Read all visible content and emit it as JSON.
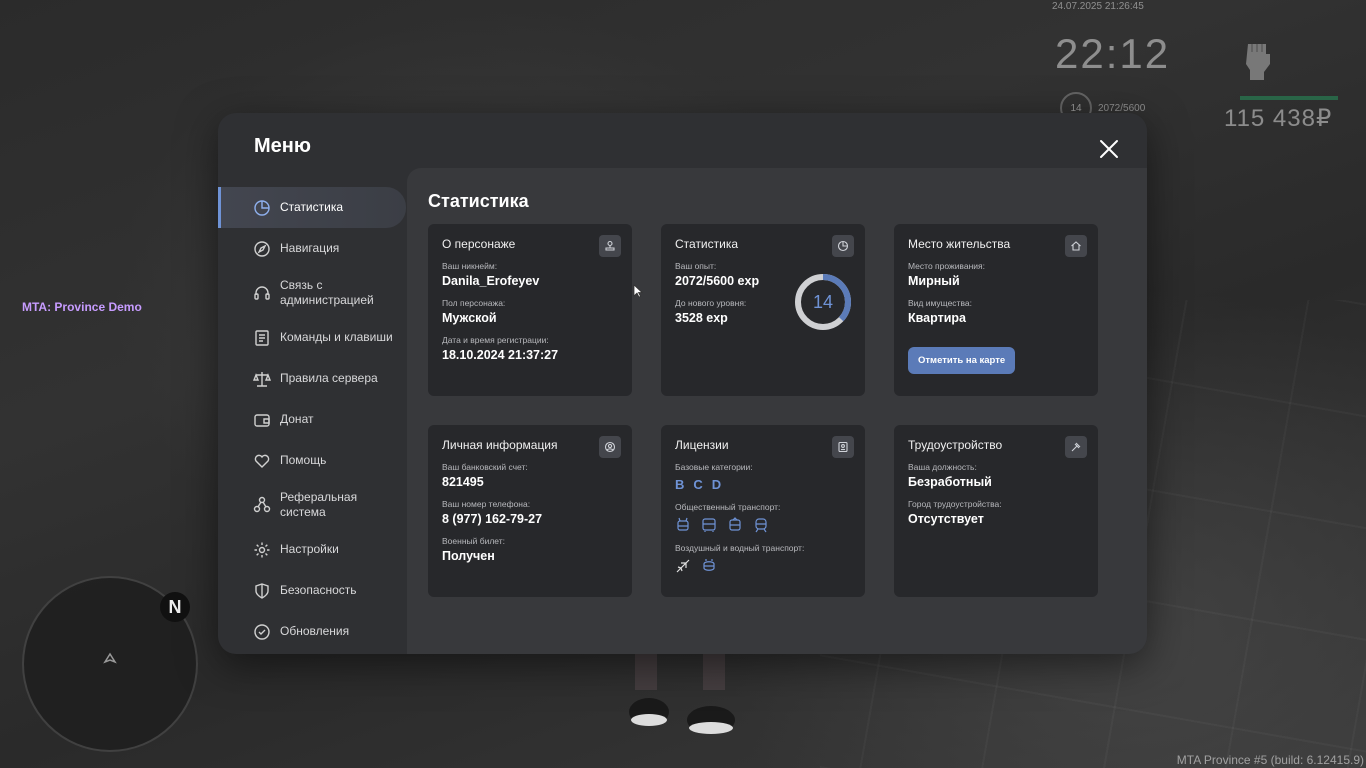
{
  "hud": {
    "date": "24.07.2025 21:26:45",
    "time": "22:12",
    "level": "14",
    "exp": "2072/5600",
    "money": "115 438₽",
    "icon": "fist-icon"
  },
  "server_label": "MTA: Province Demo",
  "build_label": "MTA Province #5 (build: 6.12415.9)",
  "minimap": {
    "compass": "N"
  },
  "menu": {
    "title": "Меню",
    "sidebar": [
      {
        "label": "Статистика",
        "icon": "pie-chart-icon",
        "active": true
      },
      {
        "label": "Навигация",
        "icon": "compass-icon"
      },
      {
        "label": "Связь с\nадминистрацией",
        "icon": "headset-icon"
      },
      {
        "label": "Команды и клавиши",
        "icon": "document-icon"
      },
      {
        "label": "Правила сервера",
        "icon": "scales-icon"
      },
      {
        "label": "Донат",
        "icon": "wallet-icon"
      },
      {
        "label": "Помощь",
        "icon": "heart-hand-icon"
      },
      {
        "label": "Реферальная\nсистема",
        "icon": "network-icon"
      },
      {
        "label": "Настройки",
        "icon": "gear-icon"
      },
      {
        "label": "Безопасность",
        "icon": "shield-icon"
      },
      {
        "label": "Обновления",
        "icon": "check-circle-icon"
      }
    ],
    "content_title": "Статистика",
    "cards": {
      "character": {
        "title": "О персонаже",
        "nick_label": "Ваш никнейм:",
        "nick": "Danila_Erofeyev",
        "gender_label": "Пол персонажа:",
        "gender": "Мужской",
        "reg_label": "Дата и время регистрации:",
        "reg": "18.10.2024 21:37:27"
      },
      "stats": {
        "title": "Статистика",
        "exp_label": "Ваш опыт:",
        "exp": "2072/5600 exp",
        "next_label": "До нового уровня:",
        "next": "3528 exp",
        "level": "14",
        "progress": 0.37
      },
      "residence": {
        "title": "Место жительства",
        "place_label": "Место проживания:",
        "place": "Мирный",
        "type_label": "Вид имущества:",
        "type": "Квартира",
        "button": "Отметить на карте"
      },
      "personal": {
        "title": "Личная информация",
        "bank_label": "Ваш банковский счет:",
        "bank": "821495",
        "phone_label": "Ваш номер телефона:",
        "phone": "8 (977) 162-79-27",
        "military_label": "Военный билет:",
        "military": "Получен"
      },
      "licenses": {
        "title": "Лицензии",
        "base_label": "Базовые категории:",
        "base": [
          "B",
          "C",
          "D"
        ],
        "public_label": "Общественный транспорт:",
        "public_icons": [
          "trolleybus-icon",
          "bus-icon",
          "tram-icon",
          "metro-icon"
        ],
        "air_label": "Воздушный и водный транспорт:",
        "air_icons": [
          "plane-icon",
          "boat-icon"
        ]
      },
      "job": {
        "title": "Трудоустройство",
        "position_label": "Ваша должность:",
        "position": "Безработный",
        "city_label": "Город трудоустройства:",
        "city": "Отсутствует"
      }
    }
  }
}
